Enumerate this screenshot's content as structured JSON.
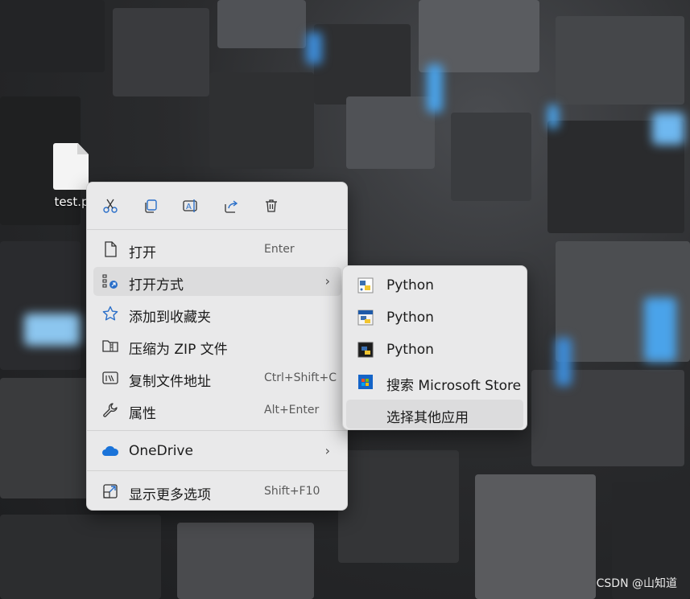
{
  "desktop": {
    "file_label": "test.p"
  },
  "context_menu": {
    "toolbar": [
      {
        "name": "cut-icon"
      },
      {
        "name": "copy-icon"
      },
      {
        "name": "rename-icon"
      },
      {
        "name": "share-icon"
      },
      {
        "name": "delete-icon"
      }
    ],
    "items": [
      {
        "label": "打开",
        "shortcut": "Enter",
        "icon": "file-icon"
      },
      {
        "label": "打开方式",
        "shortcut": "",
        "icon": "open-with-icon",
        "submenu": true
      },
      {
        "label": "添加到收藏夹",
        "shortcut": "",
        "icon": "star-icon"
      },
      {
        "label": "压缩为 ZIP 文件",
        "shortcut": "",
        "icon": "zip-folder-icon"
      },
      {
        "label": "复制文件地址",
        "shortcut": "Ctrl+Shift+C",
        "icon": "copy-path-icon"
      },
      {
        "label": "属性",
        "shortcut": "Alt+Enter",
        "icon": "wrench-icon"
      },
      {
        "label": "OneDrive",
        "shortcut": "",
        "icon": "onedrive-icon",
        "submenu": true
      },
      {
        "label": "显示更多选项",
        "shortcut": "Shift+F10",
        "icon": "more-options-icon"
      }
    ],
    "chevron": "›"
  },
  "open_with_submenu": {
    "items": [
      {
        "label": "Python",
        "icon": "python-idle-icon"
      },
      {
        "label": "Python",
        "icon": "python-icon"
      },
      {
        "label": "Python",
        "icon": "python-console-icon"
      },
      {
        "label": "搜索 Microsoft Store",
        "icon": "microsoft-store-icon"
      },
      {
        "label": "选择其他应用",
        "icon": ""
      }
    ]
  },
  "watermark": "CSDN @山知道",
  "colors": {
    "menu_bg": "#e9e9ea",
    "highlight": "#dcdcdd",
    "accent_blue": "#1a73d9"
  }
}
